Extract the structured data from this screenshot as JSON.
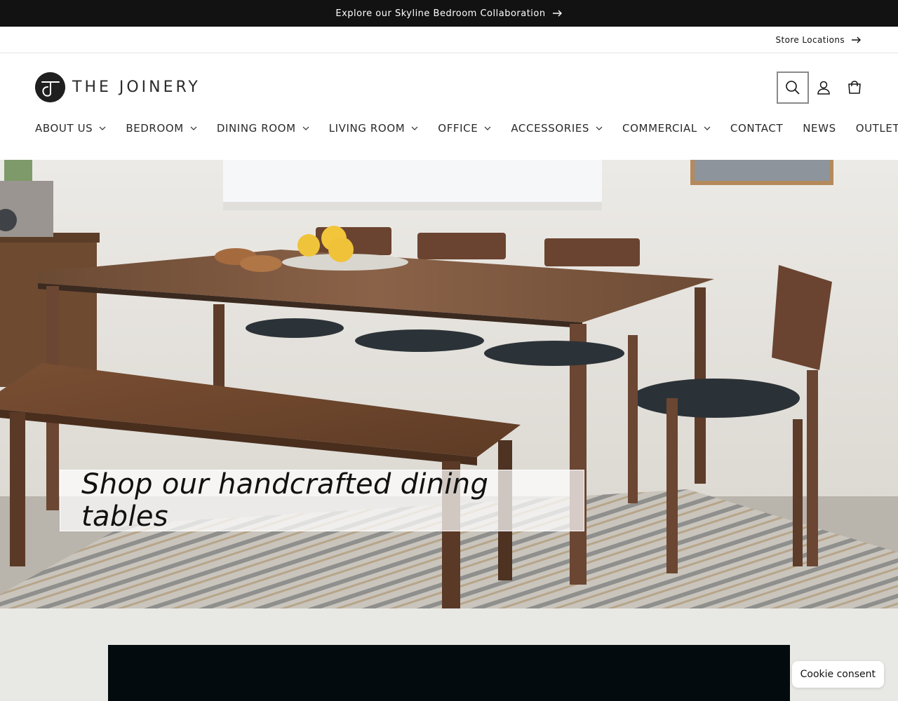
{
  "announcement": {
    "text": "Explore our Skyline Bedroom Collaboration"
  },
  "utility": {
    "store_locations": "Store Locations"
  },
  "brand": {
    "name": "THE JOINERY"
  },
  "header_icons": [
    "search-icon",
    "account-icon",
    "cart-icon"
  ],
  "nav": [
    {
      "label": "ABOUT US",
      "dropdown": true
    },
    {
      "label": "BEDROOM",
      "dropdown": true
    },
    {
      "label": "DINING ROOM",
      "dropdown": true
    },
    {
      "label": "LIVING ROOM",
      "dropdown": true
    },
    {
      "label": "OFFICE",
      "dropdown": true
    },
    {
      "label": "ACCESSORIES",
      "dropdown": true
    },
    {
      "label": "COMMERCIAL",
      "dropdown": true
    },
    {
      "label": "CONTACT",
      "dropdown": false
    },
    {
      "label": "NEWS",
      "dropdown": false
    },
    {
      "label": "OUTLET",
      "dropdown": false
    }
  ],
  "hero": {
    "caption": "Shop our handcrafted dining tables"
  },
  "cookie": {
    "label": "Cookie consent"
  },
  "colors": {
    "announcement_bg": "#121212",
    "section_bg": "#e8e8e5",
    "video_bg": "#030b0e"
  }
}
